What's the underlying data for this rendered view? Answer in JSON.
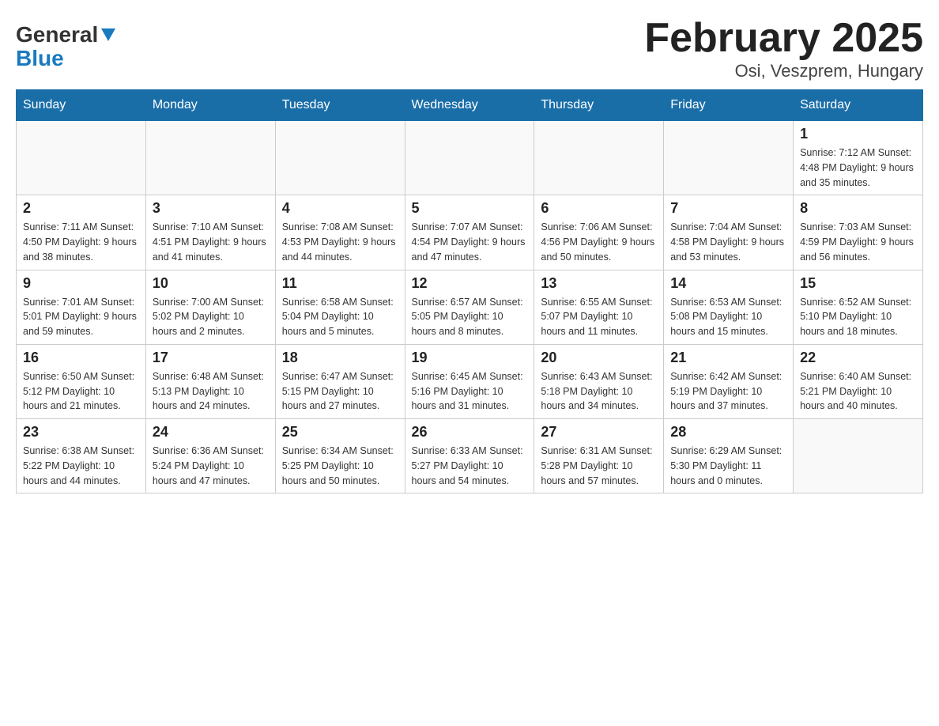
{
  "header": {
    "logo_general": "General",
    "logo_blue": "Blue",
    "month_title": "February 2025",
    "location": "Osi, Veszprem, Hungary"
  },
  "weekdays": [
    "Sunday",
    "Monday",
    "Tuesday",
    "Wednesday",
    "Thursday",
    "Friday",
    "Saturday"
  ],
  "weeks": [
    [
      {
        "day": "",
        "info": ""
      },
      {
        "day": "",
        "info": ""
      },
      {
        "day": "",
        "info": ""
      },
      {
        "day": "",
        "info": ""
      },
      {
        "day": "",
        "info": ""
      },
      {
        "day": "",
        "info": ""
      },
      {
        "day": "1",
        "info": "Sunrise: 7:12 AM\nSunset: 4:48 PM\nDaylight: 9 hours and 35 minutes."
      }
    ],
    [
      {
        "day": "2",
        "info": "Sunrise: 7:11 AM\nSunset: 4:50 PM\nDaylight: 9 hours and 38 minutes."
      },
      {
        "day": "3",
        "info": "Sunrise: 7:10 AM\nSunset: 4:51 PM\nDaylight: 9 hours and 41 minutes."
      },
      {
        "day": "4",
        "info": "Sunrise: 7:08 AM\nSunset: 4:53 PM\nDaylight: 9 hours and 44 minutes."
      },
      {
        "day": "5",
        "info": "Sunrise: 7:07 AM\nSunset: 4:54 PM\nDaylight: 9 hours and 47 minutes."
      },
      {
        "day": "6",
        "info": "Sunrise: 7:06 AM\nSunset: 4:56 PM\nDaylight: 9 hours and 50 minutes."
      },
      {
        "day": "7",
        "info": "Sunrise: 7:04 AM\nSunset: 4:58 PM\nDaylight: 9 hours and 53 minutes."
      },
      {
        "day": "8",
        "info": "Sunrise: 7:03 AM\nSunset: 4:59 PM\nDaylight: 9 hours and 56 minutes."
      }
    ],
    [
      {
        "day": "9",
        "info": "Sunrise: 7:01 AM\nSunset: 5:01 PM\nDaylight: 9 hours and 59 minutes."
      },
      {
        "day": "10",
        "info": "Sunrise: 7:00 AM\nSunset: 5:02 PM\nDaylight: 10 hours and 2 minutes."
      },
      {
        "day": "11",
        "info": "Sunrise: 6:58 AM\nSunset: 5:04 PM\nDaylight: 10 hours and 5 minutes."
      },
      {
        "day": "12",
        "info": "Sunrise: 6:57 AM\nSunset: 5:05 PM\nDaylight: 10 hours and 8 minutes."
      },
      {
        "day": "13",
        "info": "Sunrise: 6:55 AM\nSunset: 5:07 PM\nDaylight: 10 hours and 11 minutes."
      },
      {
        "day": "14",
        "info": "Sunrise: 6:53 AM\nSunset: 5:08 PM\nDaylight: 10 hours and 15 minutes."
      },
      {
        "day": "15",
        "info": "Sunrise: 6:52 AM\nSunset: 5:10 PM\nDaylight: 10 hours and 18 minutes."
      }
    ],
    [
      {
        "day": "16",
        "info": "Sunrise: 6:50 AM\nSunset: 5:12 PM\nDaylight: 10 hours and 21 minutes."
      },
      {
        "day": "17",
        "info": "Sunrise: 6:48 AM\nSunset: 5:13 PM\nDaylight: 10 hours and 24 minutes."
      },
      {
        "day": "18",
        "info": "Sunrise: 6:47 AM\nSunset: 5:15 PM\nDaylight: 10 hours and 27 minutes."
      },
      {
        "day": "19",
        "info": "Sunrise: 6:45 AM\nSunset: 5:16 PM\nDaylight: 10 hours and 31 minutes."
      },
      {
        "day": "20",
        "info": "Sunrise: 6:43 AM\nSunset: 5:18 PM\nDaylight: 10 hours and 34 minutes."
      },
      {
        "day": "21",
        "info": "Sunrise: 6:42 AM\nSunset: 5:19 PM\nDaylight: 10 hours and 37 minutes."
      },
      {
        "day": "22",
        "info": "Sunrise: 6:40 AM\nSunset: 5:21 PM\nDaylight: 10 hours and 40 minutes."
      }
    ],
    [
      {
        "day": "23",
        "info": "Sunrise: 6:38 AM\nSunset: 5:22 PM\nDaylight: 10 hours and 44 minutes."
      },
      {
        "day": "24",
        "info": "Sunrise: 6:36 AM\nSunset: 5:24 PM\nDaylight: 10 hours and 47 minutes."
      },
      {
        "day": "25",
        "info": "Sunrise: 6:34 AM\nSunset: 5:25 PM\nDaylight: 10 hours and 50 minutes."
      },
      {
        "day": "26",
        "info": "Sunrise: 6:33 AM\nSunset: 5:27 PM\nDaylight: 10 hours and 54 minutes."
      },
      {
        "day": "27",
        "info": "Sunrise: 6:31 AM\nSunset: 5:28 PM\nDaylight: 10 hours and 57 minutes."
      },
      {
        "day": "28",
        "info": "Sunrise: 6:29 AM\nSunset: 5:30 PM\nDaylight: 11 hours and 0 minutes."
      },
      {
        "day": "",
        "info": ""
      }
    ]
  ]
}
